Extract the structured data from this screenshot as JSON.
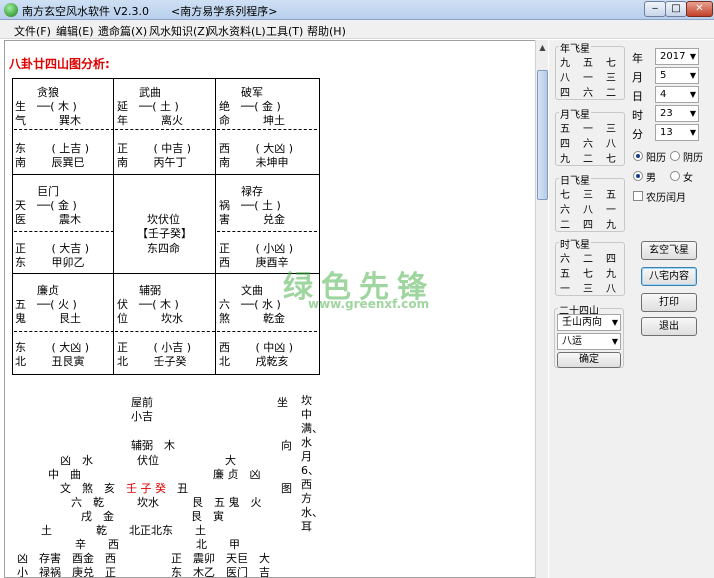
{
  "window": {
    "title": "南方玄空风水软件 V2.3.0　　<南方易学系列程序>",
    "min_label": "‒",
    "max_label": "□",
    "close_label": "✕"
  },
  "menu": [
    "文件(F)",
    "编辑(E)",
    "遗命篇(X)",
    "风水知识(Z)",
    "风水资料(L)",
    "工具(T)",
    "帮助(H)"
  ],
  "content": {
    "heading": "八卦廿四山图分析:",
    "grid": [
      [
        "贪狼",
        "武曲",
        "破军"
      ],
      [
        "巨门",
        "坎伏位",
        "禄存"
      ],
      [
        "廉贞",
        "辅弼",
        "文曲"
      ]
    ],
    "cells": {
      "tl": {
        "l1": "生　──(  木  )",
        "l2": "气　　　巽木",
        "l3": "东　　 ( 上吉 )",
        "l4": "南　　 辰巽巳"
      },
      "tm": {
        "l1": "延　──(  土  )",
        "l2": "年　　　离火",
        "l3": "正　　 ( 中吉 )",
        "l4": "南　　 丙午丁"
      },
      "tr": {
        "l1": "绝　──(  金  )",
        "l2": "命　　　坤土",
        "l3": "西　　 ( 大凶 )",
        "l4": "南　　 未坤申"
      },
      "ml": {
        "l1": "天　──(  金  )",
        "l2": "医　　　震木",
        "l3": "正　　 ( 大吉 )",
        "l4": "东　　 甲卯乙"
      },
      "mc": {
        "l1": "坎伏位",
        "l2": "【壬子癸】",
        "l3": "东四命"
      },
      "mr": {
        "l1": "祸　──(  土  )",
        "l2": "害　　　兑金",
        "l3": "正　　 ( 小凶 )",
        "l4": "西　　 庚酉辛"
      },
      "bl": {
        "l1": "五　──(  火  )",
        "l2": "鬼　　　艮土",
        "l3": "东　　 ( 大凶 )",
        "l4": "北　　 丑艮寅"
      },
      "bm": {
        "l1": "伏　──(  木  )",
        "l2": "位　　　坎水",
        "l3": "正　　 ( 小吉 )",
        "l4": "北　　 壬子癸"
      },
      "br": {
        "l1": "六　──(  水  )",
        "l2": "煞　　　乾金",
        "l3": "西　　 ( 中凶 )",
        "l4": "北　　 戌乾亥"
      }
    },
    "lower": {
      "house_front": "屋前",
      "xiao_ji": "小吉",
      "zuo": "坐",
      "right_col": "坎中满、水月6、西方水、耳",
      "r1": "辅弼　木",
      "r2": "凶　水　　　　伏位　　　　　　大",
      "r3": "中　曲　　　　　　　　　　　　廉 贞　凶",
      "r4a": "文　煞　亥　",
      "r4b": "壬 子 癸",
      "r4c": "丑",
      "r5": "六　乾　　　坎水　　　艮　五 鬼　火",
      "r6": "戌　金　　　　　　　艮　寅",
      "r7": "土　　　　乾　　北正北东　　土",
      "r8": "辛　　西　　　　　　　北　　甲",
      "r9": "凶　存害　酉金　西　　　　　正　震卯　天巨　大",
      "r10": "小　禄祸　庚兑　正　　　　　东　木乙　医门　吉",
      "xiang": "向",
      "tu": "图"
    },
    "watermark": "绿色先锋",
    "watermark_url": "www.greenxf.com"
  },
  "panel": {
    "year_group": "年飞星",
    "year_stars": [
      "九",
      "五",
      "七",
      "八",
      "一",
      "三",
      "四",
      "六",
      "二"
    ],
    "month_group": "月飞星",
    "month_stars": [
      "五",
      "一",
      "三",
      "四",
      "六",
      "八",
      "九",
      "二",
      "七"
    ],
    "day_group": "日飞星",
    "day_stars": [
      "七",
      "三",
      "五",
      "六",
      "八",
      "一",
      "二",
      "四",
      "九"
    ],
    "hour_group": "时飞星",
    "hour_stars": [
      "六",
      "二",
      "四",
      "五",
      "七",
      "九",
      "一",
      "三",
      "八"
    ],
    "labels": {
      "year": "年",
      "month": "月",
      "day": "日",
      "hour": "时",
      "minute": "分"
    },
    "values": {
      "year": "2017",
      "month": "5",
      "day": "4",
      "hour": "23",
      "minute": "13"
    },
    "solar": "阳历",
    "lunar": "阴历",
    "male": "男",
    "female": "女",
    "leap": "农历闰月",
    "mountain_group": "二十四山",
    "mountain_value": "壬山丙向",
    "yun_value": "八运",
    "confirm": "确定",
    "btn_xuankong": "玄空飞星",
    "btn_bazhai": "八宅内容",
    "btn_print": "打印",
    "btn_exit": "退出"
  }
}
